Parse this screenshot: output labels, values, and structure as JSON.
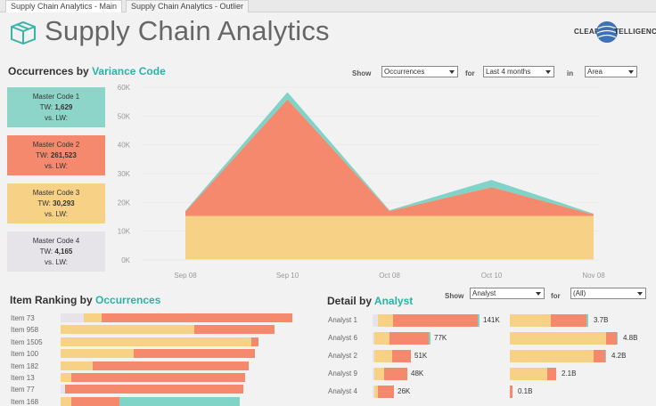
{
  "tabs": [
    {
      "label": "Supply Chain Analytics - Main",
      "active": true
    },
    {
      "label": "Supply Chain Analytics - Outlier",
      "active": false
    }
  ],
  "header": {
    "title": "Supply Chain Analytics",
    "logo_icon": "box-icon",
    "brand_left": "CLEAR",
    "brand_right": "TELLIGENCE"
  },
  "colors": {
    "teal": "#7fd3c7",
    "salmon": "#f4896e",
    "yellow": "#f7d186",
    "gray": "#e6e4e8",
    "accent": "#2ab3a6"
  },
  "occurrences": {
    "title_prefix": "Occurrences by",
    "title_accent": "Variance Code",
    "show_label": "Show",
    "show_value": "Occurrences",
    "for_label": "for",
    "for_value": "Last 4 months",
    "in_label": "in",
    "in_value": "Area"
  },
  "master_codes": [
    {
      "name": "Master Code 1",
      "tw_label": "TW:",
      "tw": "1,629",
      "lw": "vs. LW:",
      "color": "#8ed5c9"
    },
    {
      "name": "Master Code 2",
      "tw_label": "TW:",
      "tw": "261,523",
      "lw": "vs. LW:",
      "color": "#f4896e"
    },
    {
      "name": "Master Code 3",
      "tw_label": "TW:",
      "tw": "30,293",
      "lw": "vs. LW:",
      "color": "#f7d186"
    },
    {
      "name": "Master Code 4",
      "tw_label": "TW:",
      "tw": "4,165",
      "lw": "vs. LW:",
      "color": "#e6e4e8"
    }
  ],
  "chart_data": {
    "type": "area",
    "x": [
      "Sep 08",
      "Sep 10",
      "Oct 08",
      "Oct 10",
      "Nov 08"
    ],
    "yticks": [
      "60K",
      "50K",
      "40K",
      "30K",
      "20K",
      "10K",
      "0K"
    ],
    "ylim": [
      0,
      60000
    ],
    "stacked": true,
    "series": [
      {
        "name": "Master Code 4",
        "color": "#e6e4e8",
        "values": [
          300,
          300,
          300,
          300,
          300
        ]
      },
      {
        "name": "Master Code 3",
        "color": "#f7d186",
        "values": [
          15000,
          15000,
          15000,
          15000,
          15000
        ]
      },
      {
        "name": "Master Code 2",
        "color": "#f4896e",
        "values": [
          1500,
          40500,
          1700,
          10000,
          500
        ]
      },
      {
        "name": "Master Code 1",
        "color": "#7fd3c7",
        "values": [
          300,
          2500,
          300,
          2500,
          300
        ]
      }
    ]
  },
  "item_ranking": {
    "title_prefix": "Item Ranking by",
    "title_accent": "Occurrences",
    "items": [
      {
        "label": "Item 73",
        "segments": [
          {
            "c": "#e6e4e8",
            "v": 26
          },
          {
            "c": "#f7d186",
            "v": 20
          },
          {
            "c": "#f4896e",
            "v": 214
          }
        ]
      },
      {
        "label": "Item 958",
        "segments": [
          {
            "c": "#f7d186",
            "v": 150
          },
          {
            "c": "#f4896e",
            "v": 90
          }
        ]
      },
      {
        "label": "Item 1505",
        "segments": [
          {
            "c": "#f7d186",
            "v": 214
          },
          {
            "c": "#f4896e",
            "v": 8
          }
        ]
      },
      {
        "label": "Item 100",
        "segments": [
          {
            "c": "#f7d186",
            "v": 82
          },
          {
            "c": "#f4896e",
            "v": 136
          }
        ]
      },
      {
        "label": "Item 182",
        "segments": [
          {
            "c": "#f7d186",
            "v": 36
          },
          {
            "c": "#f4896e",
            "v": 175
          }
        ]
      },
      {
        "label": "Item 13",
        "segments": [
          {
            "c": "#f7d186",
            "v": 12
          },
          {
            "c": "#f4896e",
            "v": 195
          }
        ]
      },
      {
        "label": "Item 77",
        "segments": [
          {
            "c": "#e6e4e8",
            "v": 5
          },
          {
            "c": "#f4896e",
            "v": 200
          }
        ]
      },
      {
        "label": "Item 168",
        "segments": [
          {
            "c": "#f7d186",
            "v": 12
          },
          {
            "c": "#f4896e",
            "v": 54
          },
          {
            "c": "#7fd3c7",
            "v": 135
          }
        ]
      }
    ]
  },
  "detail": {
    "title_prefix": "Detail by",
    "title_accent": "Analyst",
    "show_label": "Show",
    "show_value": "Analyst",
    "for_label": "for",
    "for_value": "(All)",
    "rows": [
      {
        "label": "Analyst 1",
        "left_value": "141K",
        "right_value": "3.7B",
        "left": [
          {
            "c": "#e6e4e8",
            "v": 6
          },
          {
            "c": "#f7d186",
            "v": 17
          },
          {
            "c": "#f4896e",
            "v": 95
          },
          {
            "c": "#7fd3c7",
            "v": 2
          }
        ],
        "right": [
          {
            "c": "#f7d186",
            "v": 46
          },
          {
            "c": "#f4896e",
            "v": 40
          },
          {
            "c": "#7fd3c7",
            "v": 2
          }
        ]
      },
      {
        "label": "Analyst 6",
        "left_value": "77K",
        "right_value": "4.8B",
        "left": [
          {
            "c": "#e6e4e8",
            "v": 2
          },
          {
            "c": "#f7d186",
            "v": 17
          },
          {
            "c": "#f4896e",
            "v": 44
          },
          {
            "c": "#7fd3c7",
            "v": 2
          }
        ],
        "right": [
          {
            "c": "#f7d186",
            "v": 108
          },
          {
            "c": "#f4896e",
            "v": 12
          },
          {
            "c": "#7fd3c7",
            "v": 1
          }
        ]
      },
      {
        "label": "Analyst 2",
        "left_value": "51K",
        "right_value": "4.2B",
        "left": [
          {
            "c": "#e6e4e8",
            "v": 2
          },
          {
            "c": "#f7d186",
            "v": 20
          },
          {
            "c": "#f4896e",
            "v": 21
          }
        ],
        "right": [
          {
            "c": "#f7d186",
            "v": 94
          },
          {
            "c": "#f4896e",
            "v": 13
          },
          {
            "c": "#7fd3c7",
            "v": 1
          }
        ]
      },
      {
        "label": "Analyst 9",
        "left_value": "48K",
        "right_value": "2.1B",
        "left": [
          {
            "c": "#e6e4e8",
            "v": 2
          },
          {
            "c": "#f7d186",
            "v": 11
          },
          {
            "c": "#f4896e",
            "v": 26
          }
        ],
        "right": [
          {
            "c": "#f7d186",
            "v": 42
          },
          {
            "c": "#f4896e",
            "v": 10
          }
        ]
      },
      {
        "label": "Analyst 4",
        "left_value": "26K",
        "right_value": "0.1B",
        "left": [
          {
            "c": "#e6e4e8",
            "v": 2
          },
          {
            "c": "#f7d186",
            "v": 4
          },
          {
            "c": "#f4896e",
            "v": 18
          }
        ],
        "right": [
          {
            "c": "#f4896e",
            "v": 3
          }
        ]
      }
    ]
  }
}
